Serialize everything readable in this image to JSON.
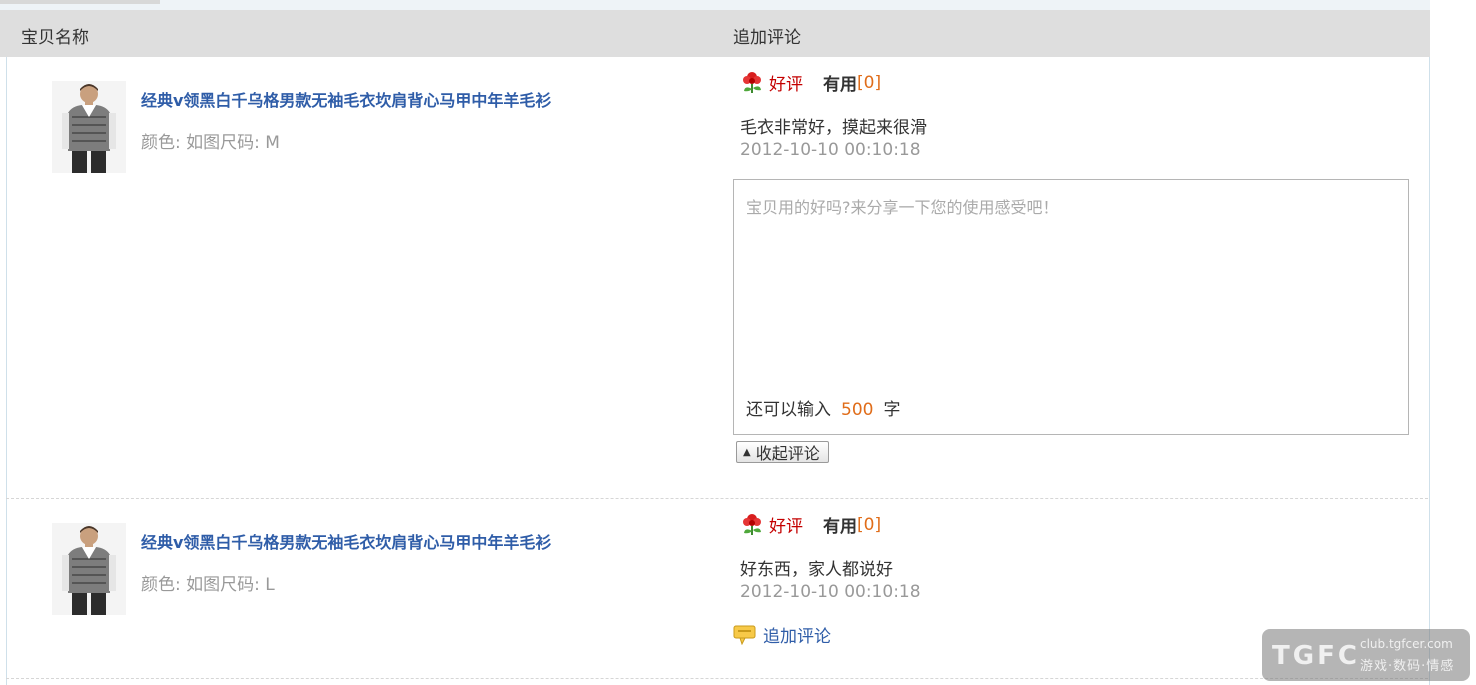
{
  "colors": {
    "link": "#2f5da8",
    "good_review": "#c40000",
    "count_accent": "#e06d1a",
    "header_bg": "#dedede"
  },
  "table_header": {
    "product_name": "宝贝名称",
    "additional_review": "追加评论"
  },
  "items": [
    {
      "title": "经典v领黑白千乌格男款无袖毛衣坎肩背心马甲中年羊毛衫",
      "sku": "颜色: 如图尺码: M",
      "rating_icon": "flower-icon",
      "rating_label": "好评",
      "useful_label": "有用",
      "useful_count": "[0]",
      "comment": "毛衣非常好，摸起来很滑",
      "date": "2012-10-10 00:10:18"
    },
    {
      "title": "经典v领黑白千乌格男款无袖毛衣坎肩背心马甲中年羊毛衫",
      "sku": "颜色: 如图尺码: L",
      "rating_icon": "flower-icon",
      "rating_label": "好评",
      "useful_label": "有用",
      "useful_count": "[0]",
      "comment": "好东西，家人都说好",
      "date": "2012-10-10 00:10:18"
    }
  ],
  "review_form": {
    "placeholder": "宝贝用的好吗?来分享一下您的使用感受吧！",
    "value": "",
    "counter_prefix": "还可以输入",
    "counter_value": "500",
    "counter_suffix": "字",
    "collapse_label": "收起评论"
  },
  "add_review": {
    "icon": "comment-bubble-icon",
    "label": "追加评论"
  },
  "watermark": {
    "logo": "TGFC",
    "site": "club.tgfcer.com",
    "tagline": "游戏·数码·情感"
  }
}
